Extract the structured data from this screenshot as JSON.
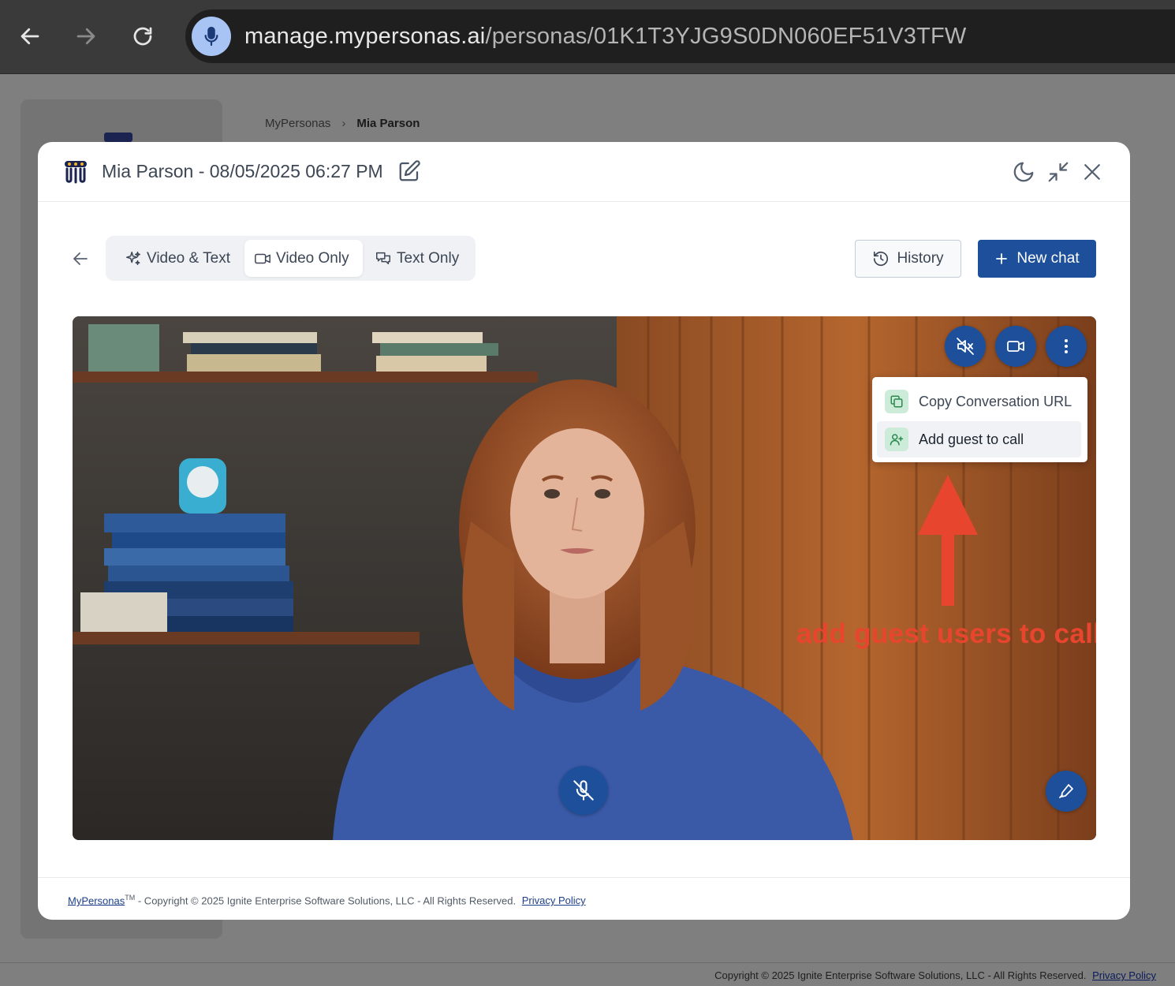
{
  "browser": {
    "url_host": "manage.mypersonas.ai",
    "url_path": "/personas/01K1T3YJG9S0DN060EF51V3TFW"
  },
  "background": {
    "breadcrumb": [
      "MyPersonas",
      "Mia Parson"
    ],
    "footer_text": "Copyright © 2025 Ignite Enterprise Software Solutions, LLC - All Rights Reserved.",
    "footer_link": "Privacy Policy"
  },
  "modal": {
    "title": "Mia Parson - 08/05/2025 06:27 PM",
    "tabs": [
      {
        "label": "Video & Text",
        "icon": "sparkles-icon",
        "active": false
      },
      {
        "label": "Video Only",
        "icon": "video-camera-icon",
        "active": true
      },
      {
        "label": "Text Only",
        "icon": "chat-bubbles-icon",
        "active": false
      }
    ],
    "history_label": "History",
    "new_chat_label": "New chat",
    "menu": [
      {
        "label": "Copy Conversation URL",
        "icon": "copy-icon"
      },
      {
        "label": "Add guest to call",
        "icon": "user-plus-icon"
      }
    ],
    "annotation": "add guest users to call",
    "footer": {
      "brand": "MyPersonas",
      "tm": "TM",
      "text": " - Copyright © 2025 Ignite Enterprise Software Solutions, LLC - All Rights Reserved.",
      "link": "Privacy Policy"
    }
  },
  "colors": {
    "primary": "#1d4f9a",
    "annotation": "#e8452f",
    "menu_icon_bg": "#cdebd9"
  }
}
